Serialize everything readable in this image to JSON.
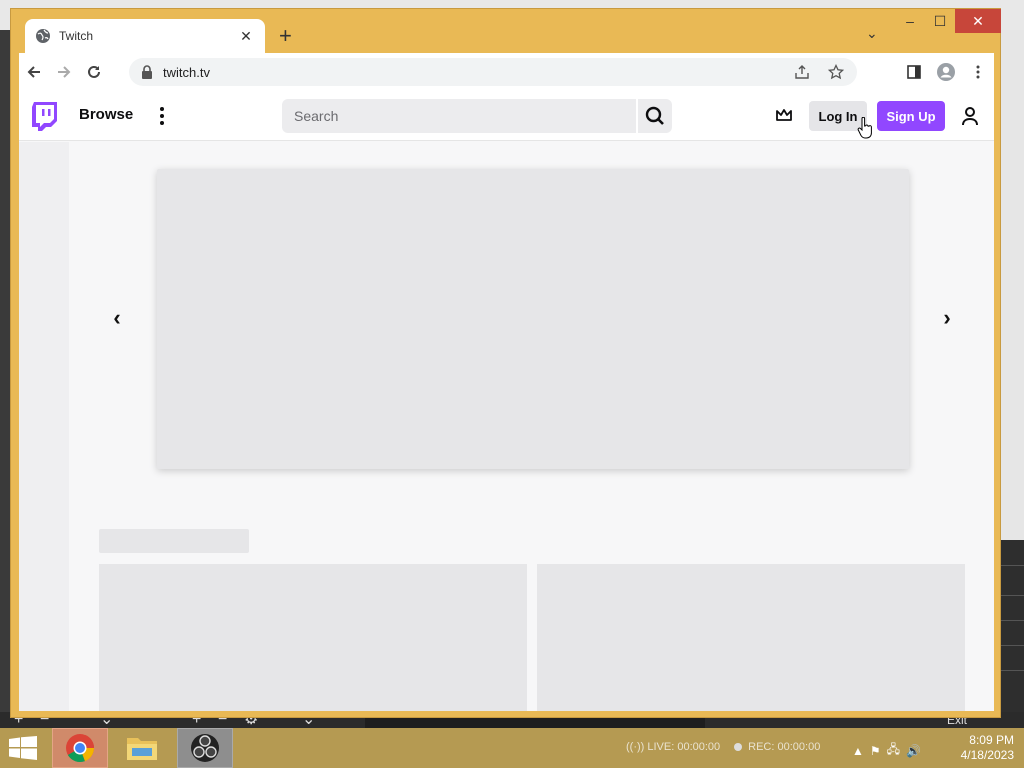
{
  "browser": {
    "tab_title": "Twitch",
    "new_tab": "+",
    "url": "twitch.tv",
    "window_controls": {
      "minimize": "–",
      "maximize": "☐",
      "close": "✕"
    }
  },
  "twitch": {
    "browse_label": "Browse",
    "search_placeholder": "Search",
    "login_label": "Log In",
    "signup_label": "Sign Up",
    "brand_color": "#9147ff"
  },
  "carousel": {
    "prev": "‹",
    "next": "›"
  },
  "background_app": {
    "exit_label": "Exit"
  },
  "taskbar": {
    "live_label": "LIVE: 00:00:00",
    "rec_label": "REC: 00:00:00",
    "time": "8:09 PM",
    "date": "4/18/2023"
  }
}
